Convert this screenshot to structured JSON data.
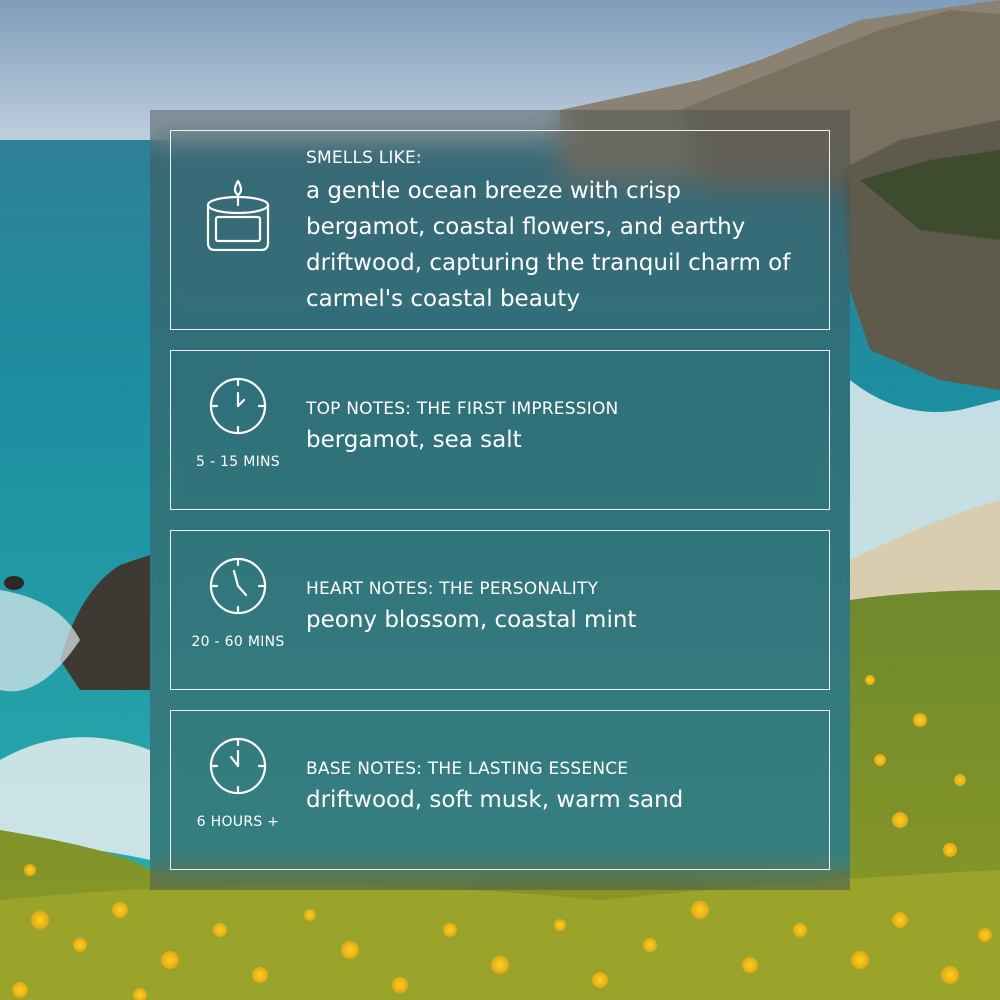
{
  "colors": {
    "sky": "#9fb8cf",
    "ocean": "#1e8a9a",
    "surf": "#e9eef0",
    "cliff": "#6b6454",
    "meadow": "#8a9a2c",
    "flowers": "#f2c020",
    "panel": "rgba(70,78,78,0.46)",
    "text": "#ffffff"
  },
  "icons": {
    "scent": "candle-icon",
    "top": "clock-icon",
    "heart": "clock-icon",
    "base": "clock-icon"
  },
  "smells_like": {
    "label": "SMELLS LIKE:",
    "description": "a gentle ocean breeze with crisp bergamot, coastal flowers, and earthy driftwood, capturing the tranquil charm of carmel's coastal beauty"
  },
  "notes": [
    {
      "label": "TOP NOTES: THE FIRST IMPRESSION",
      "value": "bergamot, sea salt",
      "duration": "5 - 15 MINS"
    },
    {
      "label": "HEART NOTES: THE PERSONALITY",
      "value": "peony blossom, coastal mint",
      "duration": "20 - 60 MINS"
    },
    {
      "label": "BASE NOTES: THE LASTING ESSENCE",
      "value": "driftwood, soft musk, warm sand",
      "duration": "6 HOURS +"
    }
  ]
}
